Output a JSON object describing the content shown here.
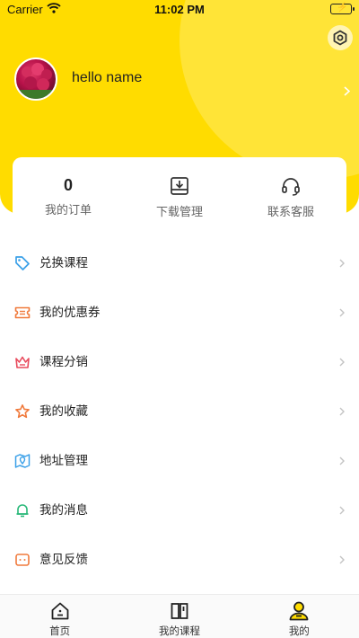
{
  "status_bar": {
    "carrier": "Carrier",
    "time": "11:02 PM"
  },
  "profile": {
    "username": "hello name"
  },
  "stats": [
    {
      "value": "0",
      "label": "我的订单"
    },
    {
      "icon": "download-icon",
      "label": "下载管理"
    },
    {
      "icon": "headset-icon",
      "label": "联系客服"
    }
  ],
  "menu": [
    {
      "label": "兑换课程",
      "icon": "tag-icon",
      "color": "#3aa0e8"
    },
    {
      "label": "我的优惠券",
      "icon": "ticket-icon",
      "color": "#f07a3c"
    },
    {
      "label": "课程分销",
      "icon": "crown-icon",
      "color": "#e84a5c"
    },
    {
      "label": "我的收藏",
      "icon": "star-icon",
      "color": "#f07a3c"
    },
    {
      "label": "地址管理",
      "icon": "map-icon",
      "color": "#3aa0e8"
    },
    {
      "label": "我的消息",
      "icon": "bell-icon",
      "color": "#28b878"
    },
    {
      "label": "意见反馈",
      "icon": "feedback-icon",
      "color": "#f07a3c"
    }
  ],
  "tabbar": [
    {
      "label": "首页",
      "icon": "home-icon"
    },
    {
      "label": "我的课程",
      "icon": "book-icon"
    },
    {
      "label": "我的",
      "icon": "profile-icon",
      "active": true
    }
  ],
  "colors": {
    "accent": "#ffdc00",
    "accent_light": "#ffe437"
  }
}
